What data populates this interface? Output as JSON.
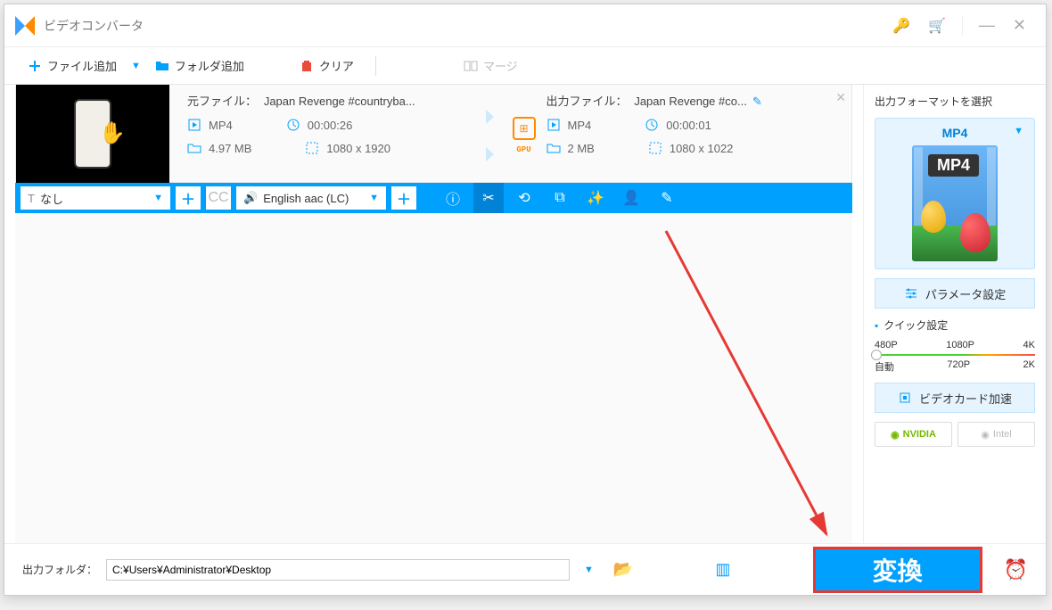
{
  "title": "ビデオコンバータ",
  "toolbar": {
    "add_file": "ファイル追加",
    "add_folder": "フォルダ追加",
    "clear": "クリア",
    "merge": "マージ"
  },
  "file": {
    "source_label": "元ファイル：",
    "source_name": "Japan Revenge #countryba...",
    "source_format": "MP4",
    "source_duration": "00:00:26",
    "source_size": "4.97 MB",
    "source_res": "1080 x 1920",
    "output_label": "出力ファイル：",
    "output_name": "Japan Revenge #co...",
    "output_format": "MP4",
    "output_duration": "00:00:01",
    "output_size": "2 MB",
    "output_res": "1080 x 1022",
    "gpu": "GPU"
  },
  "tools": {
    "subtitle_none": "なし",
    "audio_track": "English aac (LC)"
  },
  "footer": {
    "output_folder_label": "出力フォルダ：",
    "output_folder_path": "C:¥Users¥Administrator¥Desktop",
    "convert": "変換"
  },
  "right": {
    "title": "出力フォーマットを選択",
    "format": "MP4",
    "param_btn": "パラメータ設定",
    "quick_title": "クイック設定",
    "ticks_top": [
      "480P",
      "1080P",
      "4K"
    ],
    "ticks_bottom": [
      "自動",
      "720P",
      "2K"
    ],
    "hw_btn": "ビデオカード加速",
    "nvidia": "NVIDIA",
    "intel": "Intel"
  }
}
